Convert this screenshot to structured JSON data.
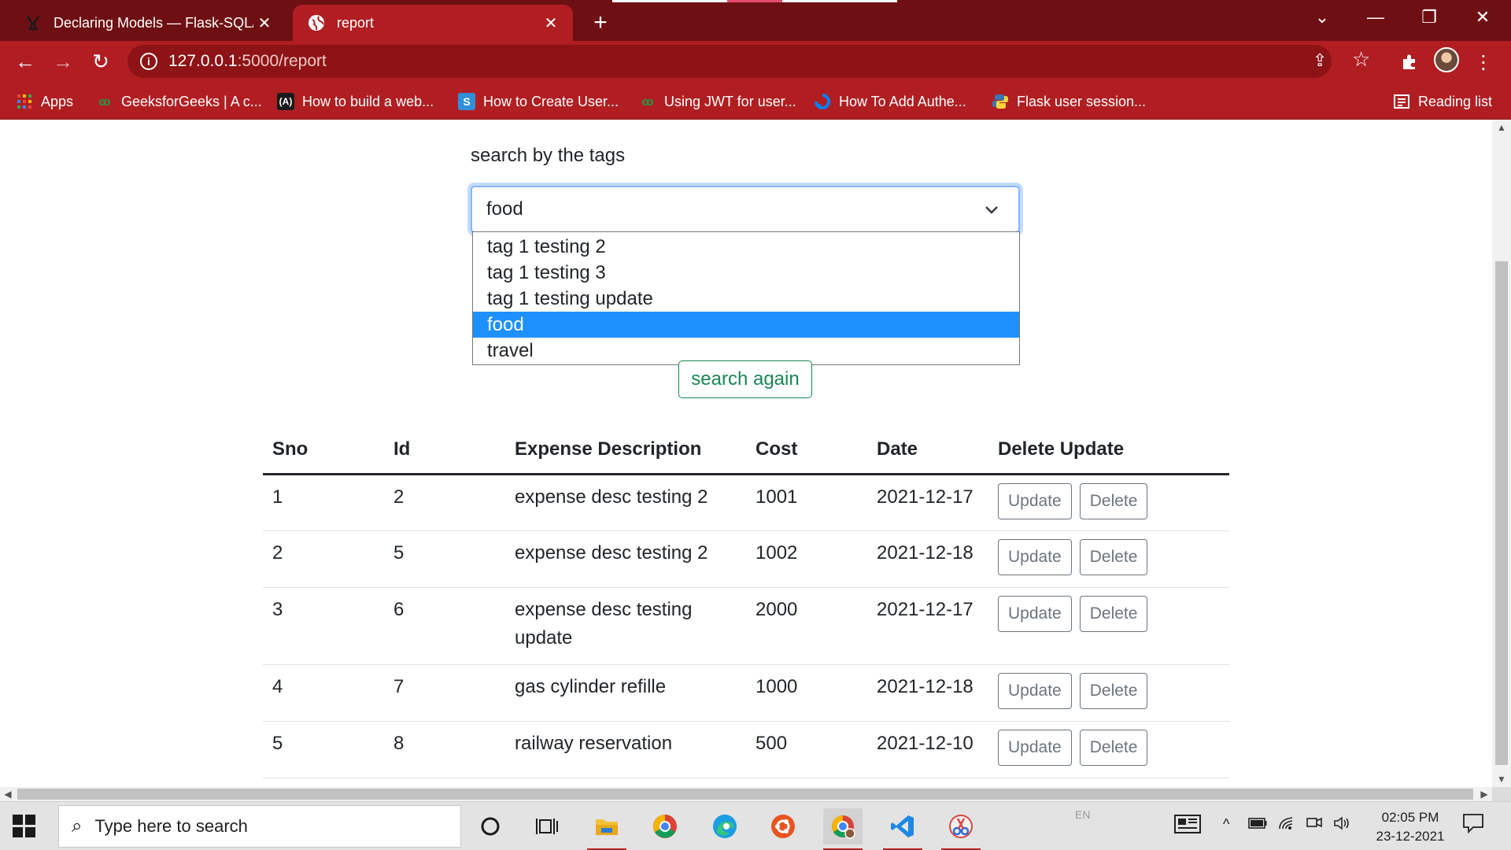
{
  "browser": {
    "tabs": [
      {
        "title": "Declaring Models — Flask-SQLAl",
        "active": false
      },
      {
        "title": "report",
        "active": true
      }
    ],
    "url_host": "127.0.0.1",
    "url_path": ":5000/report",
    "bookmarks": [
      {
        "label": "Apps",
        "icon": "apps-grid-icon"
      },
      {
        "label": "GeeksforGeeks | A c...",
        "icon": "geeksforgeeks-icon"
      },
      {
        "label": "How to build a web...",
        "icon": "a-logo-icon"
      },
      {
        "label": "How to Create User...",
        "icon": "s-logo-icon"
      },
      {
        "label": "Using JWT for user...",
        "icon": "geeksforgeeks-icon"
      },
      {
        "label": "How To Add Authe...",
        "icon": "digitalocean-icon"
      },
      {
        "label": "Flask user session...",
        "icon": "python-icon"
      }
    ],
    "reading_list": "Reading list",
    "colors": {
      "frame": "#6e1013",
      "toolbar": "#b01e22",
      "omnibox": "#8d1316"
    }
  },
  "form": {
    "label": "search by the tags",
    "selected": "food",
    "options": [
      "tag 1 testing 2",
      "tag 1 testing 3",
      "tag 1 testing update",
      "food",
      "travel"
    ],
    "highlighted_index": 3,
    "search_button": "search again"
  },
  "table": {
    "headers": [
      "Sno",
      "Id",
      "Expense Description",
      "Cost",
      "Date",
      "Delete Update"
    ],
    "rows": [
      {
        "sno": "1",
        "id": "2",
        "desc": "expense desc testing 2",
        "cost": "1001",
        "date": "2021-12-17"
      },
      {
        "sno": "2",
        "id": "5",
        "desc": "expense desc testing 2",
        "cost": "1002",
        "date": "2021-12-18"
      },
      {
        "sno": "3",
        "id": "6",
        "desc": "expense desc testing update",
        "cost": "2000",
        "date": "2021-12-17"
      },
      {
        "sno": "4",
        "id": "7",
        "desc": "gas cylinder refille",
        "cost": "1000",
        "date": "2021-12-18"
      },
      {
        "sno": "5",
        "id": "8",
        "desc": "railway reservation",
        "cost": "500",
        "date": "2021-12-10"
      }
    ],
    "update_label": "Update",
    "delete_label": "Delete"
  },
  "taskbar": {
    "search_placeholder": "Type here to search",
    "lang": "EN",
    "time": "02:05 PM",
    "date": "23-12-2021"
  }
}
